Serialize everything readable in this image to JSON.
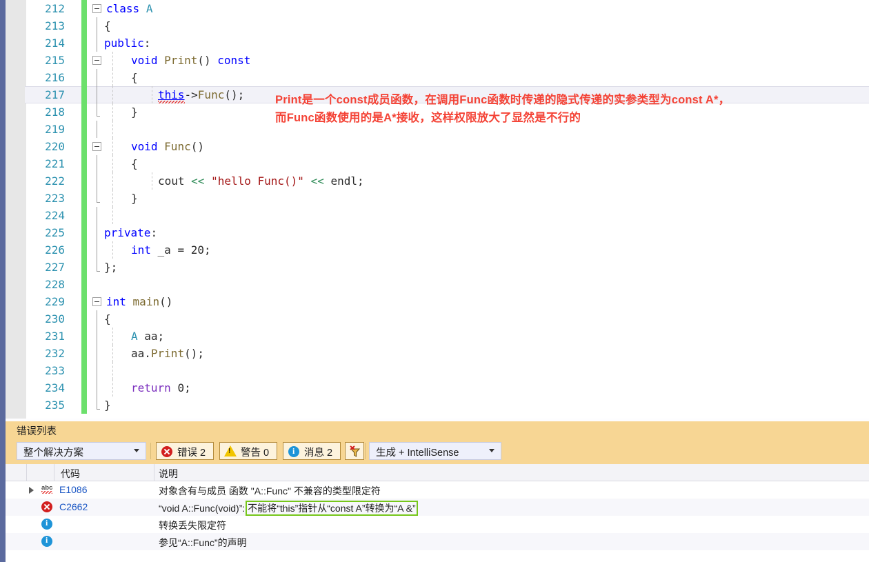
{
  "editor": {
    "first_line": 212,
    "current_line": 217,
    "lines": [
      {
        "n": 212,
        "text": "class A"
      },
      {
        "n": 213,
        "text": "{"
      },
      {
        "n": 214,
        "text": "public:"
      },
      {
        "n": 215,
        "text": "    void Print() const"
      },
      {
        "n": 216,
        "text": "    {"
      },
      {
        "n": 217,
        "text": "        this->Func();"
      },
      {
        "n": 218,
        "text": "    }"
      },
      {
        "n": 219,
        "text": ""
      },
      {
        "n": 220,
        "text": "    void Func()"
      },
      {
        "n": 221,
        "text": "    {"
      },
      {
        "n": 222,
        "text": "        cout << \"hello Func()\" << endl;"
      },
      {
        "n": 223,
        "text": "    }"
      },
      {
        "n": 224,
        "text": ""
      },
      {
        "n": 225,
        "text": "private:"
      },
      {
        "n": 226,
        "text": "    int _a = 20;"
      },
      {
        "n": 227,
        "text": "};"
      },
      {
        "n": 228,
        "text": ""
      },
      {
        "n": 229,
        "text": "int main()"
      },
      {
        "n": 230,
        "text": "{"
      },
      {
        "n": 231,
        "text": "    A aa;"
      },
      {
        "n": 232,
        "text": "    aa.Print();"
      },
      {
        "n": 233,
        "text": ""
      },
      {
        "n": 234,
        "text": "    return 0;"
      },
      {
        "n": 235,
        "text": "}"
      }
    ]
  },
  "annotation": {
    "color": "#f44336",
    "line1": "Print是一个const成员函数，在调用Func函数时传递的隐式传递的实参类型为const A*，",
    "line2": "而Func函数使用的是A*接收，这样权限放大了显然是不行的"
  },
  "error_panel": {
    "title": "错误列表",
    "scope_filter": "整个解决方案",
    "build_filter": "生成 + IntelliSense",
    "counters": [
      {
        "id": "errors",
        "label": "错误 2",
        "icon": "error-icon"
      },
      {
        "id": "warnings",
        "label": "警告 0",
        "icon": "warning-icon"
      },
      {
        "id": "messages",
        "label": "消息 2",
        "icon": "info-icon"
      }
    ],
    "filter_button_icon": "filter-funnel-icon",
    "columns": [
      "代码",
      "说明"
    ],
    "rows": [
      {
        "icon": "intellisense-abc-icon",
        "expandable": true,
        "code": "E1086",
        "desc": "对象含有与成员 函数 \"A::Func\" 不兼容的类型限定符",
        "highlight": false
      },
      {
        "icon": "error-icon",
        "expandable": false,
        "code": "C2662",
        "desc_prefix": "“void A::Func(void)”: ",
        "desc_highlighted": "不能将“this”指针从“const A”转换为“A &”",
        "desc": "“void A::Func(void)”: 不能将“this”指针从“const A”转换为“A &”",
        "highlight": true,
        "highlight_color": "#76c61a"
      },
      {
        "icon": "info-icon",
        "expandable": false,
        "code": "",
        "desc": "转换丢失限定符",
        "highlight": false
      },
      {
        "icon": "info-icon",
        "expandable": false,
        "code": "",
        "desc": "参见“A::Func”的声明",
        "highlight": false
      }
    ]
  }
}
